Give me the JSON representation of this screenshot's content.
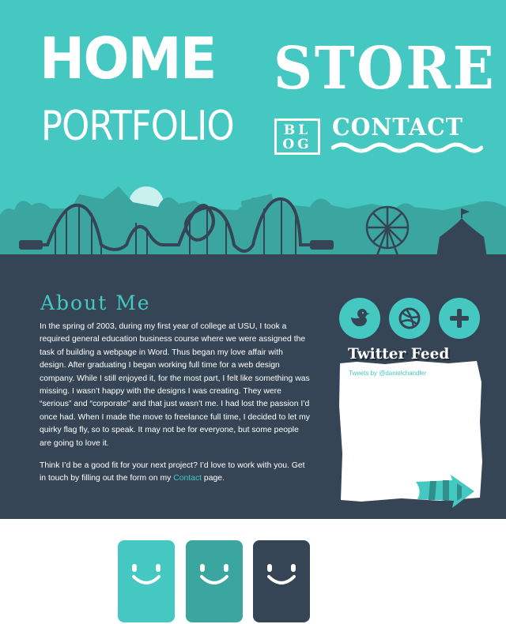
{
  "nav": {
    "home": "HOME",
    "store": "STORE",
    "portfolio": "PORTFOLIO",
    "blog_line1": "BL",
    "blog_line2": "OG",
    "contact": "CONTACT"
  },
  "colors": {
    "teal": "#45c8c1",
    "teal_dark": "#3aa69f",
    "navy": "#364555",
    "white": "#ffffff"
  },
  "about": {
    "title": "About Me",
    "paragraph1": "In the spring of 2003, during my first year of college at USU, I took a required general education business course where we were assigned the task of building a webpage in Word. Thus began my love affair with design. After graduating I began working full time for a web design company. While I still enjoyed it, for the most part, I felt like something was missing. I wasn’t happy with the designs I was creating. They were “serious” and “corporate” and that just wasn’t me. I had lost the passion I’d once had. When I made the move to freelance full time, I decided to let my quirky flag fly, so to speak. It may not be for everyone, but some people are going to love it.",
    "paragraph2_before": "Think I’d be a good fit for your next project? I’d love to work with you. Get in touch by filling out the form on my ",
    "paragraph2_link": "Contact",
    "paragraph2_after": " page."
  },
  "social": {
    "icons": [
      "twitter-bird-icon",
      "dribbble-icon",
      "plus-icon"
    ]
  },
  "twitter": {
    "title": "Twitter Feed",
    "byline": "Tweets by @danielchandler"
  },
  "faces": {
    "icons": [
      "smiley-face-icon",
      "smiley-face-icon",
      "smiley-face-icon"
    ],
    "colors": [
      "#45c8c1",
      "#3aa69f",
      "#364555"
    ]
  }
}
